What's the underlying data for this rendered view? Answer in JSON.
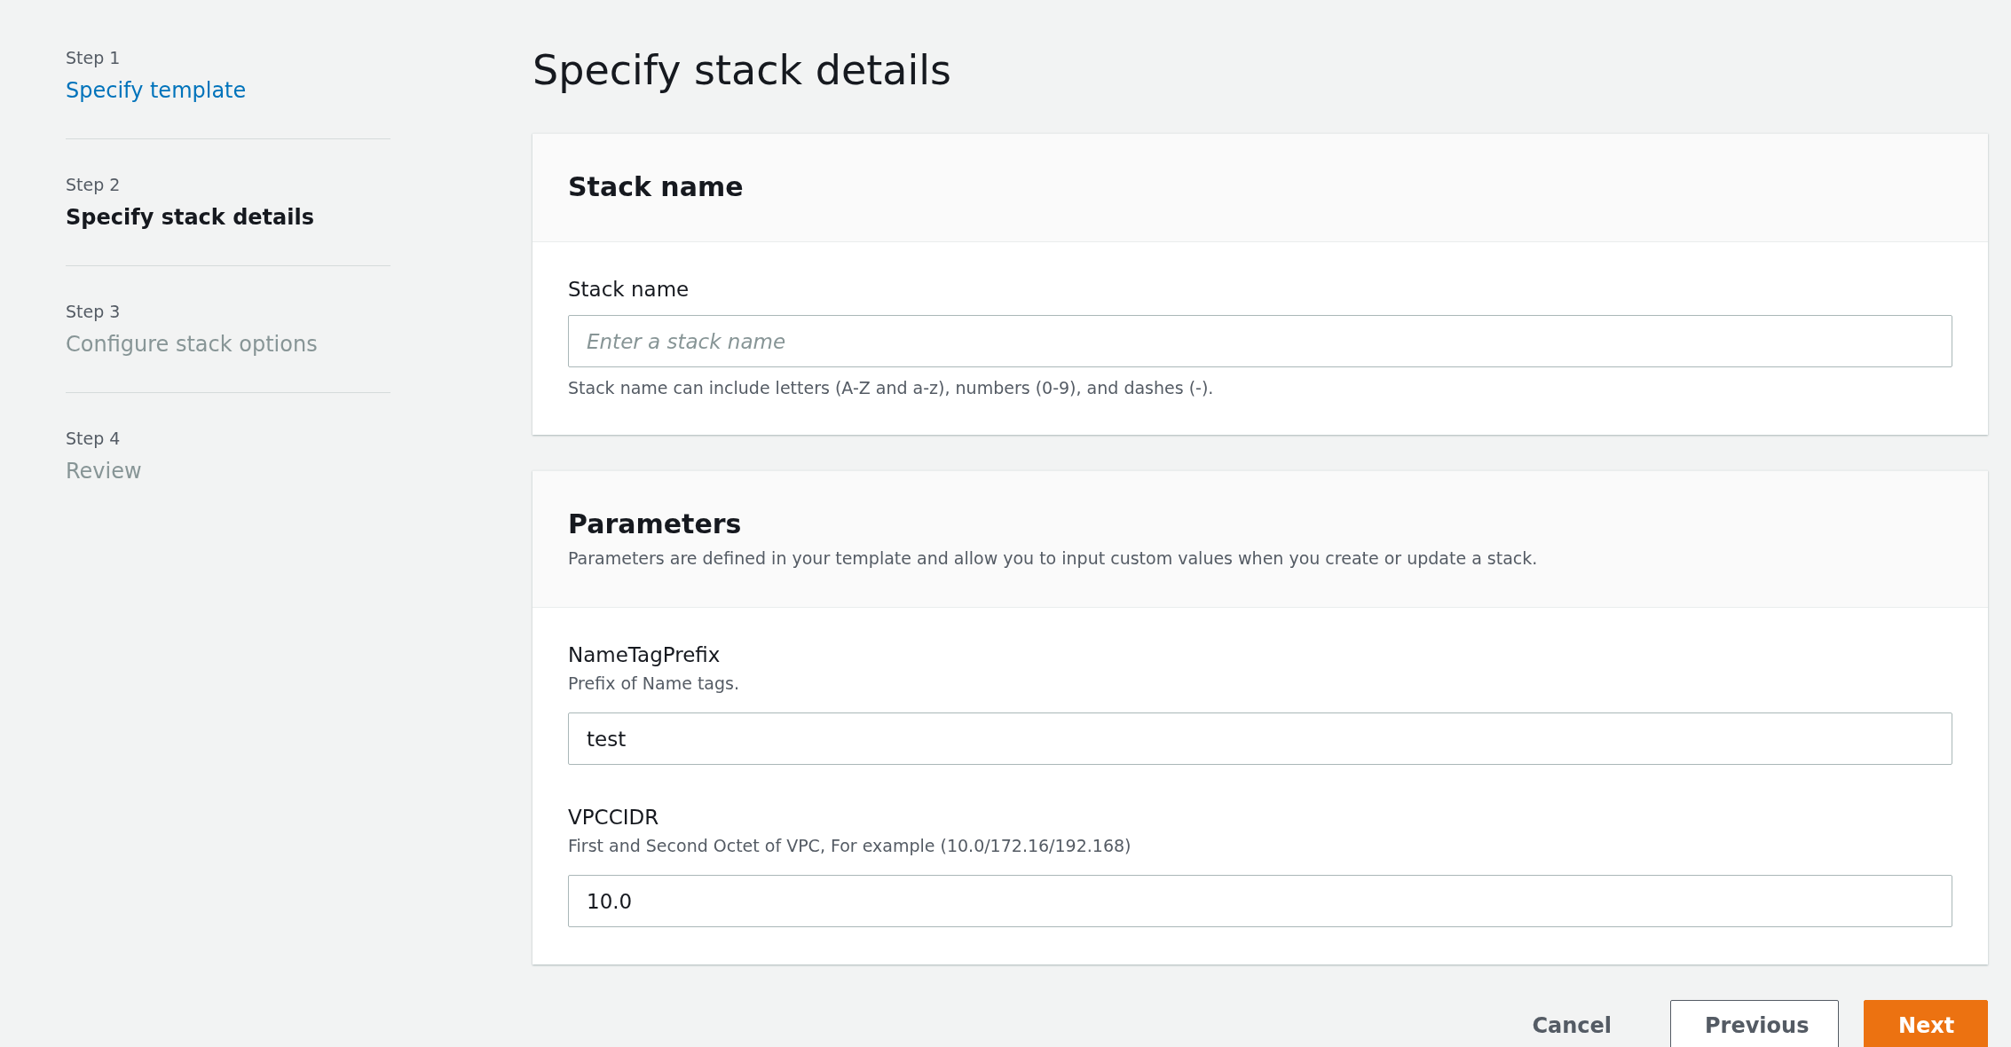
{
  "steps": [
    {
      "step": "Step 1",
      "label": "Specify template",
      "selected": false,
      "disabled": false
    },
    {
      "step": "Step 2",
      "label": "Specify stack details",
      "selected": true,
      "disabled": false
    },
    {
      "step": "Step 3",
      "label": "Configure stack options",
      "selected": false,
      "disabled": true
    },
    {
      "step": "Step 4",
      "label": "Review",
      "selected": false,
      "disabled": true
    }
  ],
  "title": "Specify stack details",
  "panels": [
    {
      "heading": "Stack name",
      "fields": [
        {
          "label": "Stack name",
          "placeholder": "Enter a stack name",
          "help": "Stack name can include letters (A-Z and a-z), numbers (0-9), and dashes (-)."
        }
      ]
    },
    {
      "heading": "Parameters",
      "description": "Parameters are defined in your template and allow you to input custom values when you create or update a stack.",
      "fields": [
        {
          "label": "NameTagPrefix",
          "description": "Prefix of Name tags.",
          "value": "test"
        },
        {
          "label": "VPCCIDR",
          "description": "First and Second Octet of VPC, For example (10.0/172.16/192.168)",
          "value": "10.0"
        }
      ]
    }
  ],
  "buttons": [
    {
      "label": "Cancel",
      "kind": "text"
    },
    {
      "label": "Previous",
      "kind": "secondary"
    },
    {
      "label": "Next",
      "kind": "primary"
    }
  ]
}
